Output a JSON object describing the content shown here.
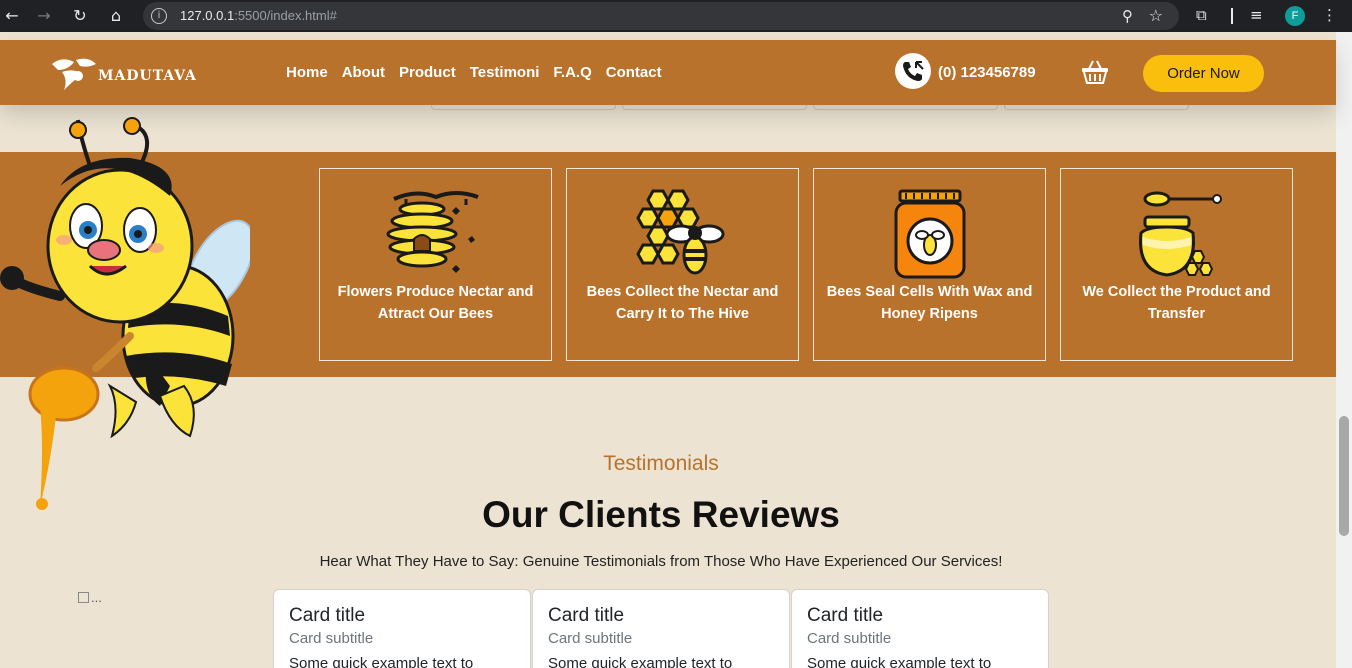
{
  "browser": {
    "url_host": "127.0.0.1",
    "url_path": ":5500/index.html#",
    "profile_initial": "F"
  },
  "header": {
    "brand": "MADUTAVA",
    "nav": [
      "Home",
      "About",
      "Product",
      "Testimoni",
      "F.A.Q",
      "Contact"
    ],
    "phone": "(0) 123456789",
    "order_label": "Order Now"
  },
  "process": [
    {
      "text": "Flowers Produce Nectar and Attract Our Bees",
      "icon": "beehive-icon"
    },
    {
      "text": "Bees Collect the Nectar and Carry It to The Hive",
      "icon": "honeycomb-bee-icon"
    },
    {
      "text": "Bees Seal Cells With Wax and Honey Ripens",
      "icon": "honey-jar-icon"
    },
    {
      "text": "We Collect the Product and Transfer",
      "icon": "honey-pot-icon"
    }
  ],
  "testimonials": {
    "eyebrow": "Testimonials",
    "title": "Our Clients Reviews",
    "subtitle": "Hear What They Have to Say: Genuine Testimonials from Those Who Have Experienced Our Services!",
    "broken_image_alt": "...",
    "cards": [
      {
        "title": "Card title",
        "subtitle": "Card subtitle",
        "text": "Some quick example text to"
      },
      {
        "title": "Card title",
        "subtitle": "Card subtitle",
        "text": "Some quick example text to"
      },
      {
        "title": "Card title",
        "subtitle": "Card subtitle",
        "text": "Some quick example text to"
      }
    ]
  },
  "colors": {
    "brand_brown": "#b9722b",
    "accent_yellow": "#f9bf0c",
    "page_bg": "#ece3d3"
  }
}
